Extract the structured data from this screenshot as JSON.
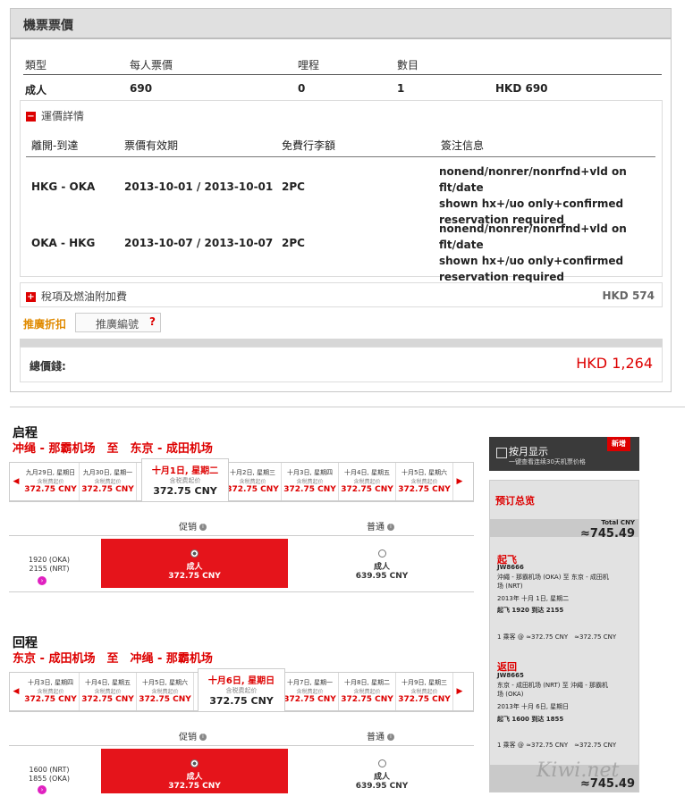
{
  "fare": {
    "title": "機票票價",
    "headers": [
      "類型",
      "每人票價",
      "哩程",
      "數目"
    ],
    "row": {
      "type": "成人",
      "price": "690",
      "miles": "0",
      "count": "1",
      "total": "HKD 690"
    },
    "detail_title": "運價詳情",
    "detail_headers": [
      "離開-到達",
      "票價有效期",
      "免費行李額",
      "簽注信息"
    ],
    "details": [
      {
        "route": "HKG - OKA",
        "valid": "2013-10-01 / 2013-10-01",
        "bag": "2PC",
        "note": [
          "nonend/nonrer/nonrfnd+vld on flt/date",
          "shown hx+/uo only+confirmed",
          "reservation required"
        ]
      },
      {
        "route": "OKA - HKG",
        "valid": "2013-10-07 / 2013-10-07",
        "bag": "2PC",
        "note": [
          "nonend/nonrer/nonrfnd+vld on flt/date",
          "shown hx+/uo only+confirmed",
          "reservation required"
        ]
      }
    ],
    "tax_label": "稅項及燃油附加費",
    "tax_value": "HKD 574",
    "promo_label": "推廣折扣",
    "promo_placeholder": "推廣編號",
    "promo_help": "?",
    "total_label": "總價錢:",
    "total_value": "HKD 1,264"
  },
  "outbound": {
    "title": "启程",
    "route": "冲绳 - 那霸机场　至　东京 - 成田机场",
    "left": [
      {
        "d": "九月29日, 星期日",
        "p": "372.75 CNY"
      },
      {
        "d": "九月30日, 星期一",
        "p": "372.75 CNY"
      }
    ],
    "selected": {
      "d": "十月1日, 星期二",
      "s": "含税费起价",
      "p": "372.75 CNY"
    },
    "right": [
      {
        "d": "十月2日, 星期三",
        "p": "372.75 CNY"
      },
      {
        "d": "十月3日, 星期四",
        "p": "372.75 CNY"
      },
      {
        "d": "十月4日, 星期五",
        "p": "372.75 CNY"
      },
      {
        "d": "十月5日, 星期六",
        "p": "372.75 CNY"
      }
    ],
    "sub": "含税费起价",
    "promo": "促销",
    "normal": "普通",
    "times": [
      "1920 (OKA)",
      "2155 (NRT)"
    ],
    "adult": "成人",
    "promo_price": "372.75 CNY",
    "normal_price": "639.95 CNY"
  },
  "inbound": {
    "title": "回程",
    "route": "东京 - 成田机场　至　冲绳 - 那霸机场",
    "left": [
      {
        "d": "十月3日, 星期四",
        "p": "372.75 CNY"
      },
      {
        "d": "十月4日, 星期五",
        "p": "372.75 CNY"
      },
      {
        "d": "十月5日, 星期六",
        "p": "372.75 CNY"
      }
    ],
    "selected": {
      "d": "十月6日, 星期日",
      "s": "含税费起价",
      "p": "372.75 CNY"
    },
    "right": [
      {
        "d": "十月7日, 星期一",
        "p": "372.75 CNY"
      },
      {
        "d": "十月8日, 星期二",
        "p": "372.75 CNY"
      },
      {
        "d": "十月9日, 星期三",
        "p": "372.75 CNY"
      }
    ],
    "sub": "含税费起价",
    "promo": "促销",
    "normal": "普通",
    "times": [
      "1600 (NRT)",
      "1855 (OKA)"
    ],
    "adult": "成人",
    "promo_price": "372.75 CNY",
    "normal_price": "639.95 CNY"
  },
  "side": {
    "month_title": "按月显示",
    "month_sub": "一键查看连续30天机票价格",
    "new_badge": "新增",
    "summary": "预订总览",
    "total_label": "Total CNY",
    "total_value": "≈745.49",
    "dep_title": "起飞",
    "dep_flight": "JW8666",
    "dep_route": "沖繩 - 那霸机场 (OKA) 至 东京 - 成田机",
    "dep_route2": "场 (NRT)",
    "dep_date": "2013年 十月 1日, 星期二",
    "dep_time": "起飞 1920 到达 2155",
    "dep_pax": "1 乘客 @ ≈372.75 CNY　≈372.75 CNY",
    "ret_title": "返回",
    "ret_flight": "JW8665",
    "ret_route": "东京 - 成田机场 (NRT) 至 沖繩 - 那霸机",
    "ret_route2": "场 (OKA)",
    "ret_date": "2013年 十月 6日, 星期日",
    "ret_time": "起飞 1600 到达 1855",
    "ret_pax": "1 乘客 @ ≈372.75 CNY　≈372.75 CNY",
    "total2": "≈745.49",
    "watermark": "Kiwi.net"
  }
}
